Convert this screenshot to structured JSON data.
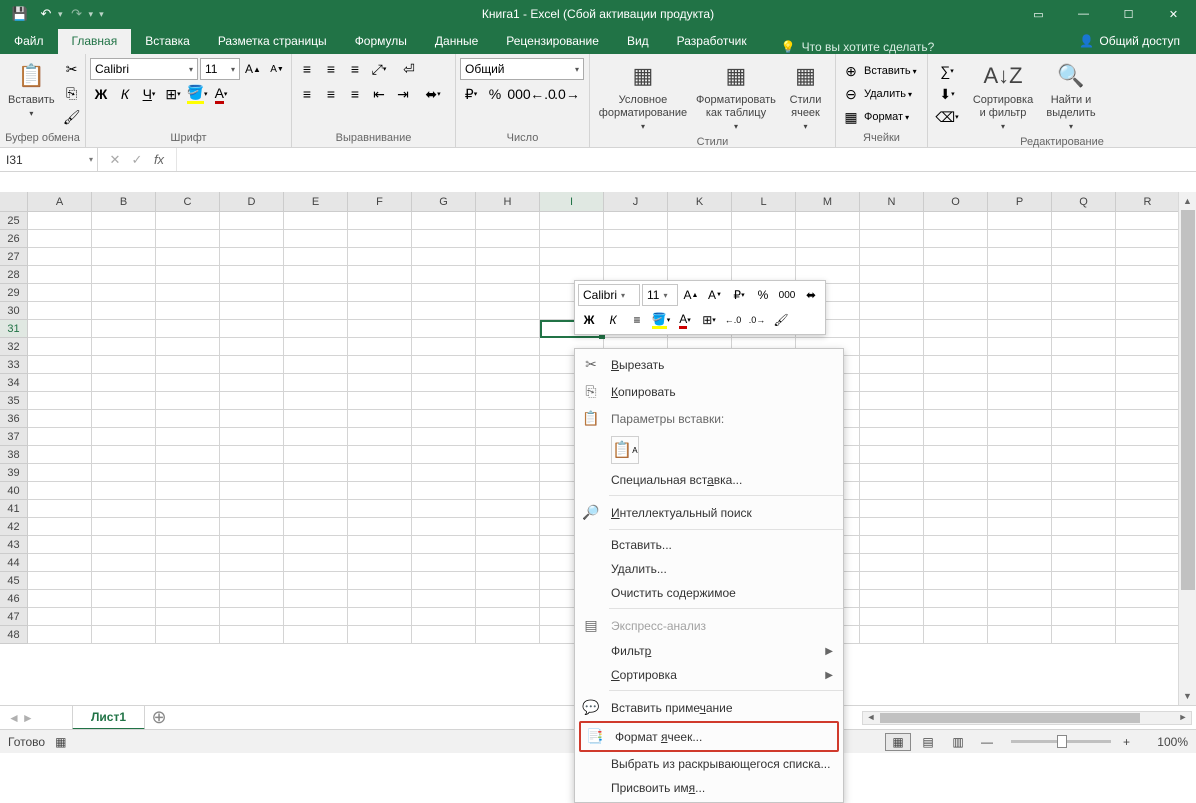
{
  "title": "Книга1 - Excel (Сбой активации продукта)",
  "tabs": {
    "file": "Файл",
    "home": "Главная",
    "insert": "Вставка",
    "pagelayout": "Разметка страницы",
    "formulas": "Формулы",
    "data": "Данные",
    "review": "Рецензирование",
    "view": "Вид",
    "developer": "Разработчик",
    "tellme": "Что вы хотите сделать?",
    "share": "Общий доступ"
  },
  "ribbon": {
    "clipboard": {
      "paste": "Вставить",
      "label": "Буфер обмена"
    },
    "font": {
      "name": "Calibri",
      "size": "11",
      "bold": "Ж",
      "italic": "К",
      "underline": "Ч",
      "label": "Шрифт"
    },
    "alignment": {
      "label": "Выравнивание"
    },
    "number": {
      "format": "Общий",
      "label": "Число"
    },
    "styles": {
      "cond": "Условное форматирование",
      "table": "Форматировать как таблицу",
      "cell": "Стили ячеек",
      "label": "Стили"
    },
    "cells": {
      "insert": "Вставить",
      "delete": "Удалить",
      "format": "Формат",
      "label": "Ячейки"
    },
    "editing": {
      "sort": "Сортировка и фильтр",
      "find": "Найти и выделить",
      "label": "Редактирование"
    }
  },
  "namebox": "I31",
  "sheet": {
    "tab1": "Лист1"
  },
  "status": {
    "ready": "Готово",
    "zoom": "100%"
  },
  "columns": [
    "A",
    "B",
    "C",
    "D",
    "E",
    "F",
    "G",
    "H",
    "I",
    "J",
    "K",
    "L",
    "M",
    "N",
    "O",
    "P",
    "Q",
    "R"
  ],
  "rows": [
    25,
    26,
    27,
    28,
    29,
    30,
    31,
    32,
    33,
    34,
    35,
    36,
    37,
    38,
    39,
    40,
    41,
    42,
    43,
    44,
    45,
    46,
    47,
    48
  ],
  "selected_cell": "I31",
  "minitoolbar": {
    "font": "Calibri",
    "size": "11"
  },
  "context_menu": {
    "cut": "Вырезать",
    "copy": "Копировать",
    "paste_header": "Параметры вставки:",
    "paste_special": "Специальная вставка...",
    "smart_lookup": "Интеллектуальный поиск",
    "insert": "Вставить...",
    "delete": "Удалить...",
    "clear": "Очистить содержимое",
    "quick_analysis": "Экспресс-анализ",
    "filter": "Фильтр",
    "sort": "Сортировка",
    "comment": "Вставить примечание",
    "format_cells": "Формат ячеек...",
    "pick_list": "Выбрать из раскрывающегося списка...",
    "define_name": "Присвоить имя..."
  }
}
